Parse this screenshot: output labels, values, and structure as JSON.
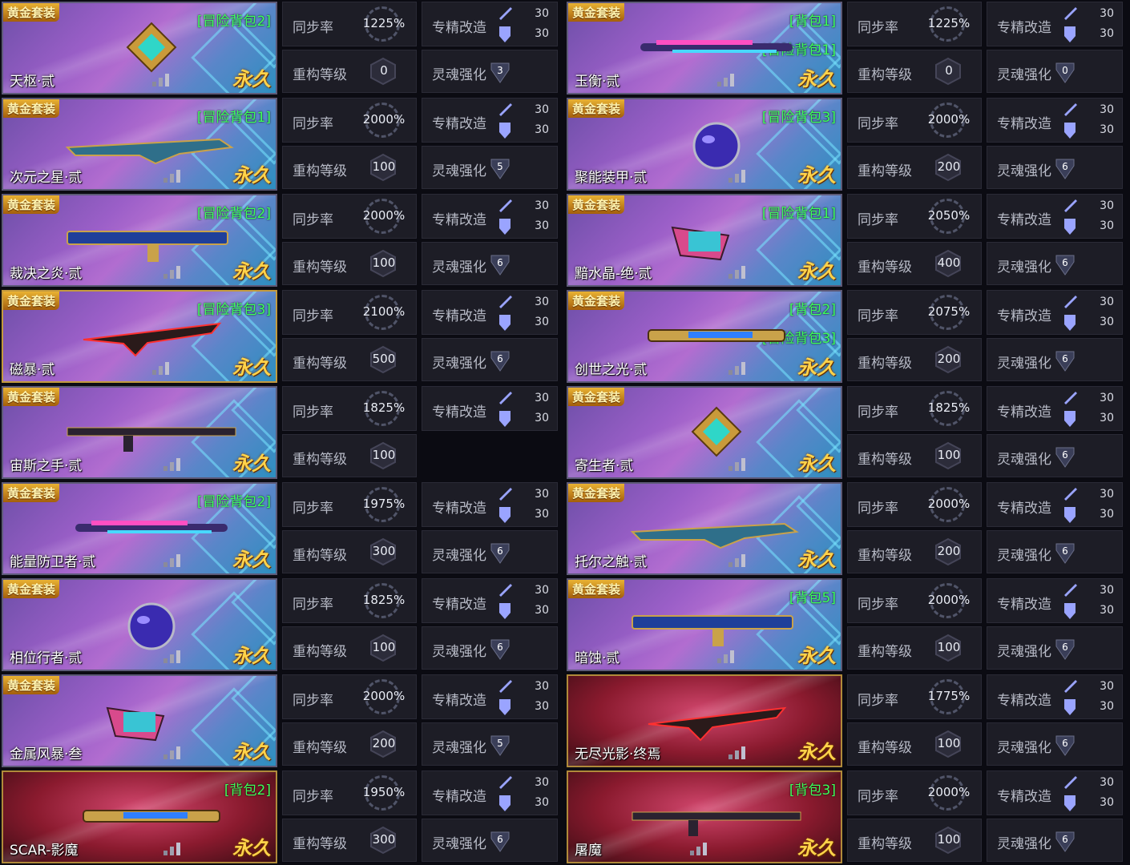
{
  "labels": {
    "tag": "黄金套装",
    "sync": "同步率",
    "rebuild": "重构等级",
    "refine": "专精改造",
    "soul": "灵魂强化",
    "permanent": "永久"
  },
  "items": [
    {
      "name": "天枢·贰",
      "bags": [
        "[冒险背包2]"
      ],
      "sync": "1225%",
      "rebuild": "0",
      "refine": [
        "30",
        "30"
      ],
      "soul": "3",
      "tag": true,
      "style": "purple"
    },
    {
      "name": "玉衡·贰",
      "bags": [
        "[背包1]",
        "[冒险背包1]"
      ],
      "sync": "1225%",
      "rebuild": "0",
      "refine": [
        "30",
        "30"
      ],
      "soul": "0",
      "tag": true,
      "style": "purple"
    },
    {
      "name": "次元之星·贰",
      "bags": [
        "[冒险背包1]"
      ],
      "sync": "2000%",
      "rebuild": "100",
      "refine": [
        "30",
        "30"
      ],
      "soul": "5",
      "tag": true,
      "style": "purple"
    },
    {
      "name": "聚能装甲·贰",
      "bags": [
        "[冒险背包3]"
      ],
      "sync": "2000%",
      "rebuild": "200",
      "refine": [
        "30",
        "30"
      ],
      "soul": "6",
      "tag": true,
      "style": "purple"
    },
    {
      "name": "裁决之炎·贰",
      "bags": [
        "[冒险背包2]"
      ],
      "sync": "2000%",
      "rebuild": "100",
      "refine": [
        "30",
        "30"
      ],
      "soul": "6",
      "tag": true,
      "style": "purple"
    },
    {
      "name": "黯水晶-绝·贰",
      "bags": [
        "[冒险背包1]"
      ],
      "sync": "2050%",
      "rebuild": "400",
      "refine": [
        "30",
        "30"
      ],
      "soul": "6",
      "tag": true,
      "style": "purple"
    },
    {
      "name": "磁暴·贰",
      "bags": [
        "[冒险背包3]"
      ],
      "sync": "2100%",
      "rebuild": "500",
      "refine": [
        "30",
        "30"
      ],
      "soul": "6",
      "tag": true,
      "style": "purple",
      "gold": true
    },
    {
      "name": "创世之光·贰",
      "bags": [
        "[背包2]",
        "[冒险背包3]"
      ],
      "sync": "2075%",
      "rebuild": "200",
      "refine": [
        "30",
        "30"
      ],
      "soul": "6",
      "tag": true,
      "style": "purple"
    },
    {
      "name": "宙斯之手·贰",
      "bags": [],
      "sync": "1825%",
      "rebuild": "100",
      "refine": [
        "30",
        "30"
      ],
      "soul": null,
      "tag": true,
      "style": "purple"
    },
    {
      "name": "寄生者·贰",
      "bags": [],
      "sync": "1825%",
      "rebuild": "100",
      "refine": [
        "30",
        "30"
      ],
      "soul": "6",
      "tag": true,
      "style": "purple"
    },
    {
      "name": "能量防卫者·贰",
      "bags": [
        "[冒险背包2]"
      ],
      "sync": "1975%",
      "rebuild": "300",
      "refine": [
        "30",
        "30"
      ],
      "soul": "6",
      "tag": true,
      "style": "purple"
    },
    {
      "name": "托尔之触·贰",
      "bags": [],
      "sync": "2000%",
      "rebuild": "200",
      "refine": [
        "30",
        "30"
      ],
      "soul": "6",
      "tag": true,
      "style": "purple"
    },
    {
      "name": "相位行者·贰",
      "bags": [],
      "sync": "1825%",
      "rebuild": "100",
      "refine": [
        "30",
        "30"
      ],
      "soul": "6",
      "tag": true,
      "style": "purple"
    },
    {
      "name": "暗蚀·贰",
      "bags": [
        "[背包5]"
      ],
      "sync": "2000%",
      "rebuild": "100",
      "refine": [
        "30",
        "30"
      ],
      "soul": "6",
      "tag": true,
      "style": "purple"
    },
    {
      "name": "金属风暴·叁",
      "bags": [],
      "sync": "2000%",
      "rebuild": "200",
      "refine": [
        "30",
        "30"
      ],
      "soul": "5",
      "tag": true,
      "style": "purple"
    },
    {
      "name": "无尽光影·终焉",
      "bags": [],
      "sync": "1775%",
      "rebuild": "100",
      "refine": [
        "30",
        "30"
      ],
      "soul": "6",
      "tag": false,
      "style": "red"
    },
    {
      "name": "SCAR-影魔",
      "bags": [
        "[背包2]"
      ],
      "sync": "1950%",
      "rebuild": "300",
      "refine": [
        "30",
        "30"
      ],
      "soul": "6",
      "tag": false,
      "style": "red"
    },
    {
      "name": "屠魔",
      "bags": [
        "[背包3]"
      ],
      "sync": "2000%",
      "rebuild": "100",
      "refine": [
        "30",
        "30"
      ],
      "soul": "6",
      "tag": false,
      "style": "red"
    }
  ],
  "colors": {
    "bag_text": "#3dff5a",
    "permanent": "#ffd34a",
    "tag_bg": "#e9b233"
  }
}
